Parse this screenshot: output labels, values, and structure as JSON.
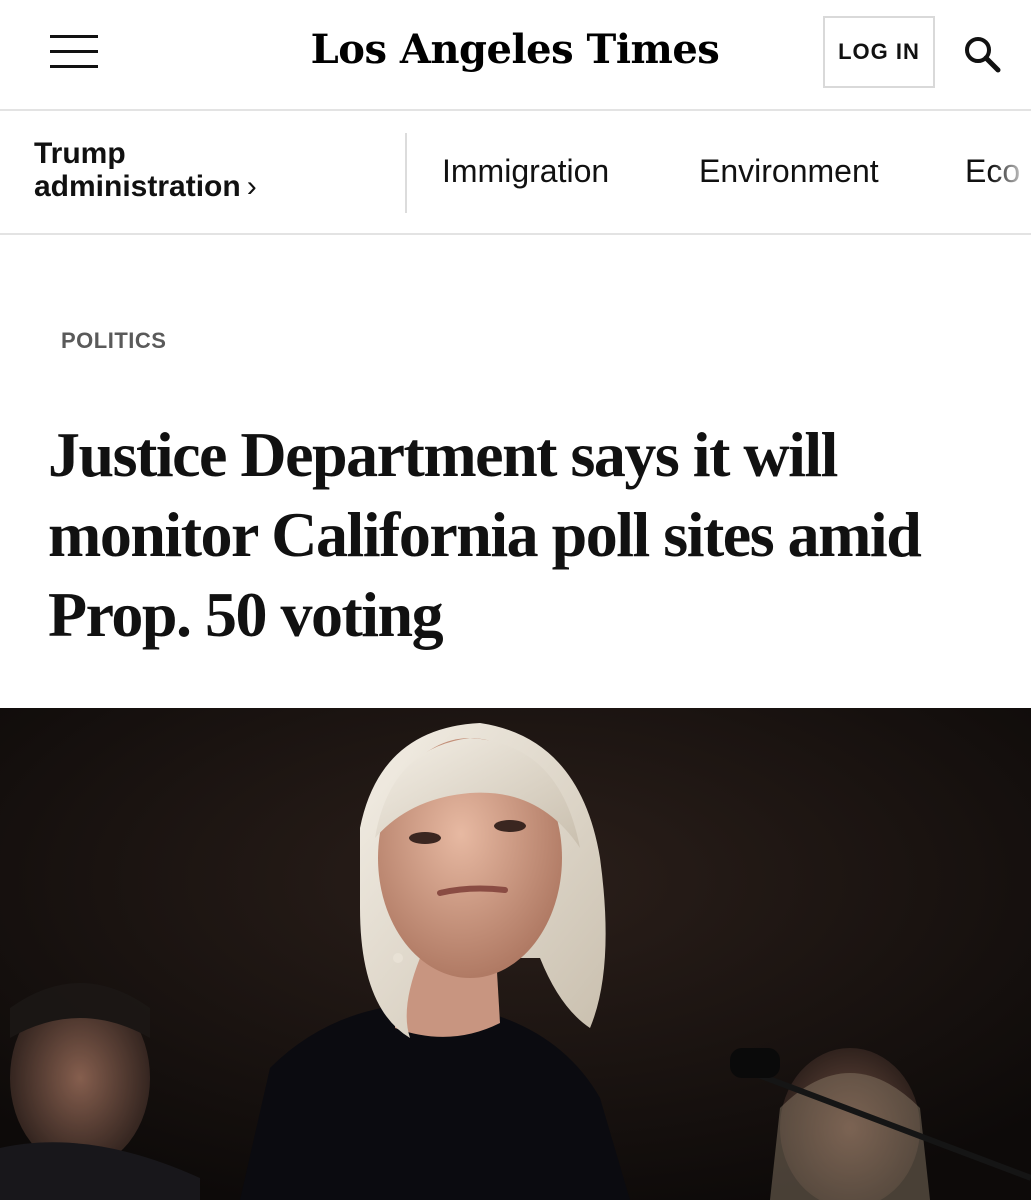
{
  "header": {
    "logo_text": "Los Angeles Times",
    "menu_icon": "hamburger-menu-icon",
    "login_label": "LOG IN",
    "search_icon": "search-icon"
  },
  "subnav": {
    "section_line1": "Trump",
    "section_line2": "administration",
    "section_chevron": "›",
    "items": [
      {
        "label": "Immigration"
      },
      {
        "label": "Environment"
      },
      {
        "label": "Eco"
      }
    ]
  },
  "article": {
    "kicker": "POLITICS",
    "headline_line1": "Justice Department says it will",
    "headline_line2": "monitor California poll sites amid",
    "headline_line3": "Prop. 50 voting"
  },
  "colors": {
    "text": "#111111",
    "kicker": "#5a5a5a",
    "divider": "#e3e3e3",
    "photo_background": "#0f0c0b"
  }
}
